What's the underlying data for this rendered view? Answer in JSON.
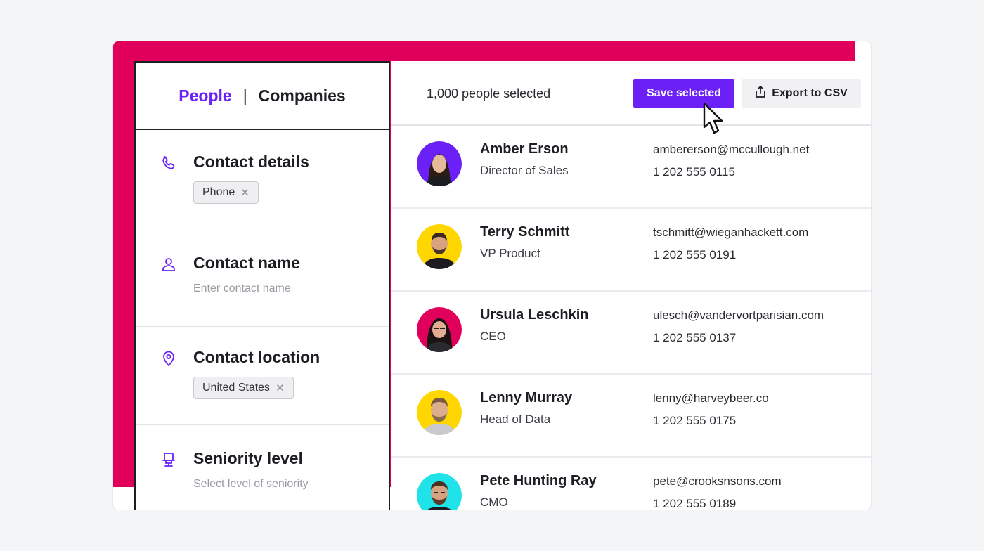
{
  "tabs": {
    "people": "People",
    "separator": "|",
    "companies": "Companies"
  },
  "filters": [
    {
      "icon": "phone-icon",
      "title": "Contact details",
      "chip": "Phone",
      "chip_remove": "✕",
      "placeholder": ""
    },
    {
      "icon": "person-icon",
      "title": "Contact name",
      "chip": "",
      "chip_remove": "",
      "placeholder": "Enter contact name"
    },
    {
      "icon": "location-pin-icon",
      "title": "Contact location",
      "chip": "United States",
      "chip_remove": "✕",
      "placeholder": ""
    },
    {
      "icon": "chair-icon",
      "title": "Seniority level",
      "chip": "",
      "chip_remove": "",
      "placeholder": "Select level of seniority"
    }
  ],
  "toolbar": {
    "selected_count": "1,000 people selected",
    "save_label": "Save selected",
    "export_label": "Export to CSV"
  },
  "people": [
    {
      "name": "Amber Erson",
      "title": "Director of Sales",
      "email": "ambererson@mccullough.net",
      "phone": "1 202 555 0115",
      "avatar_bg": "#6b21f5"
    },
    {
      "name": "Terry Schmitt",
      "title": "VP Product",
      "email": "tschmitt@wieganhackett.com",
      "phone": "1 202 555 0191",
      "avatar_bg": "#ffd600"
    },
    {
      "name": "Ursula Leschkin",
      "title": "CEO",
      "email": "ulesch@vandervortparisian.com",
      "phone": "1 202 555 0137",
      "avatar_bg": "#e0005c"
    },
    {
      "name": "Lenny Murray",
      "title": "Head of Data",
      "email": "lenny@harveybeer.co",
      "phone": "1 202 555 0175",
      "avatar_bg": "#ffd600"
    },
    {
      "name": "Pete Hunting Ray",
      "title": "CMO",
      "email": "pete@crooksnsons.com",
      "phone": "1 202 555 0189",
      "avatar_bg": "#20e3ea"
    }
  ],
  "colors": {
    "accent": "#e0005c",
    "brand": "#6b21f5"
  }
}
